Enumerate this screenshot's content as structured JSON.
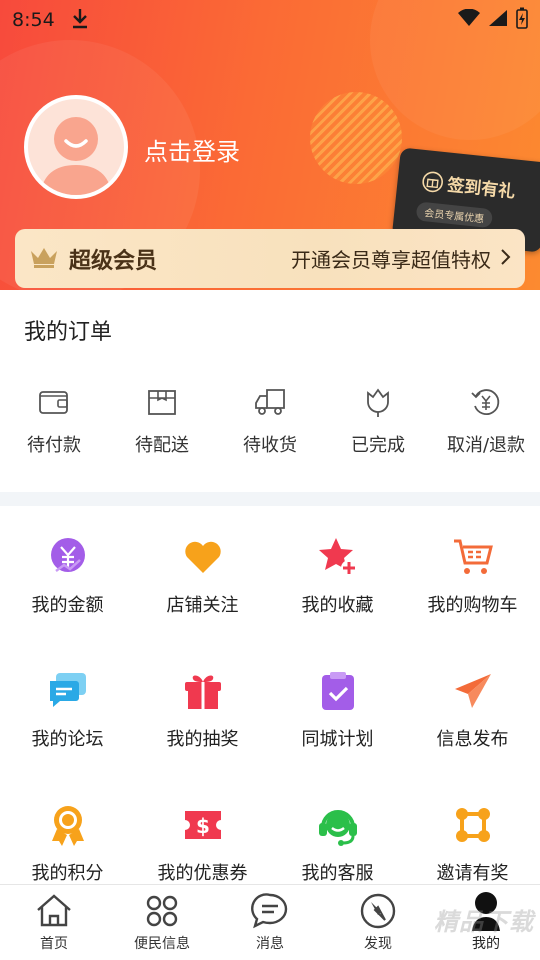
{
  "status_bar": {
    "time": "8:54"
  },
  "profile": {
    "login_prompt": "点击登录"
  },
  "checkin": {
    "title": "签到有礼",
    "subtitle": "会员专属优惠"
  },
  "vip": {
    "title": "超级会员",
    "description": "开通会员尊享超值特权"
  },
  "orders": {
    "title": "我的订单",
    "items": [
      {
        "label": "待付款",
        "icon": "wallet-icon"
      },
      {
        "label": "待配送",
        "icon": "box-icon"
      },
      {
        "label": "待收货",
        "icon": "truck-icon"
      },
      {
        "label": "已完成",
        "icon": "tulip-icon"
      },
      {
        "label": "取消/退款",
        "icon": "refund-icon"
      }
    ]
  },
  "services": [
    {
      "label": "我的金额",
      "icon": "yen-coin-icon",
      "color": "#a35de8"
    },
    {
      "label": "店铺关注",
      "icon": "heart-icon",
      "color": "#f7a21b"
    },
    {
      "label": "我的收藏",
      "icon": "star-plus-icon",
      "color": "#f0394f"
    },
    {
      "label": "我的购物车",
      "icon": "cart-icon",
      "color": "#f36b39"
    },
    {
      "label": "我的论坛",
      "icon": "chat-icon",
      "color": "#2aa9e6"
    },
    {
      "label": "我的抽奖",
      "icon": "gift-icon",
      "color": "#f0394f"
    },
    {
      "label": "同城计划",
      "icon": "clipboard-check-icon",
      "color": "#a35de8"
    },
    {
      "label": "信息发布",
      "icon": "paper-plane-icon",
      "color": "#f36b39"
    },
    {
      "label": "我的积分",
      "icon": "medal-icon",
      "color": "#f7a21b"
    },
    {
      "label": "我的优惠券",
      "icon": "coupon-icon",
      "color": "#f0394f"
    },
    {
      "label": "我的客服",
      "icon": "headset-icon",
      "color": "#2bbf4a"
    },
    {
      "label": "邀请有奖",
      "icon": "share-nodes-icon",
      "color": "#f7a21b"
    }
  ],
  "tabbar": [
    {
      "label": "首页",
      "icon": "home-icon"
    },
    {
      "label": "便民信息",
      "icon": "grid-circles-icon"
    },
    {
      "label": "消息",
      "icon": "message-icon"
    },
    {
      "label": "发现",
      "icon": "compass-icon"
    },
    {
      "label": "我的",
      "icon": "person-icon",
      "active": true
    }
  ],
  "watermark": "精品下载"
}
